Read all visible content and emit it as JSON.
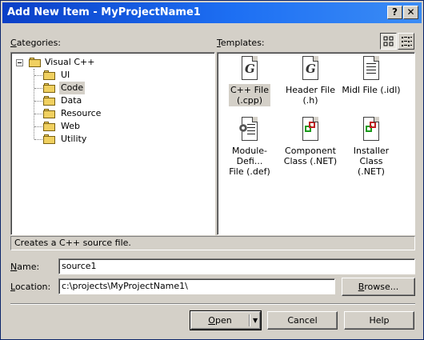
{
  "window": {
    "title": "Add New Item - MyProjectName1"
  },
  "categories": {
    "label": "Categories:",
    "mnemonic": "C",
    "label_rest": "ategories:",
    "root": "Visual C++",
    "items": [
      {
        "label": "UI",
        "selected": false
      },
      {
        "label": "Code",
        "selected": true
      },
      {
        "label": "Data",
        "selected": false
      },
      {
        "label": "Resource",
        "selected": false
      },
      {
        "label": "Web",
        "selected": false
      },
      {
        "label": "Utility",
        "selected": false
      }
    ]
  },
  "templates": {
    "label": "Templates:",
    "mnemonic": "T",
    "label_rest": "emplates:",
    "items": [
      {
        "line1": "C++ File",
        "line2": "(.cpp)",
        "icon": "cpp-file-icon",
        "selected": true
      },
      {
        "line1": "Header File",
        "line2": "(.h)",
        "icon": "header-file-icon",
        "selected": false
      },
      {
        "line1": "Midl File (.idl)",
        "line2": "",
        "icon": "midl-file-icon",
        "selected": false
      },
      {
        "line1": "Module-Defi...",
        "line2": "File (.def)",
        "icon": "module-definition-file-icon",
        "selected": false
      },
      {
        "line1": "Component",
        "line2": "Class (.NET)",
        "icon": "component-class-icon",
        "selected": false
      },
      {
        "line1": "Installer Class",
        "line2": "(.NET)",
        "icon": "installer-class-icon",
        "selected": false
      }
    ],
    "view_large_icon": "large-icons-view-icon",
    "view_small_icon": "small-icons-view-icon"
  },
  "status": {
    "description": "Creates a C++ source file."
  },
  "name": {
    "label": "Name:",
    "mnemonic": "N",
    "label_rest": "ame:",
    "value": "source1"
  },
  "location": {
    "label": "Location:",
    "mnemonic": "L",
    "label_rest": "ocation:",
    "value": "c:\\projects\\MyProjectName1\\"
  },
  "buttons": {
    "browse_mnemonic": "B",
    "browse_rest": "rowse...",
    "open_mnemonic": "O",
    "open_rest": "pen",
    "cancel": "Cancel",
    "help": "Help"
  },
  "colors": {
    "titlebar": "#0a3fc7",
    "face": "#d4d0c8"
  }
}
